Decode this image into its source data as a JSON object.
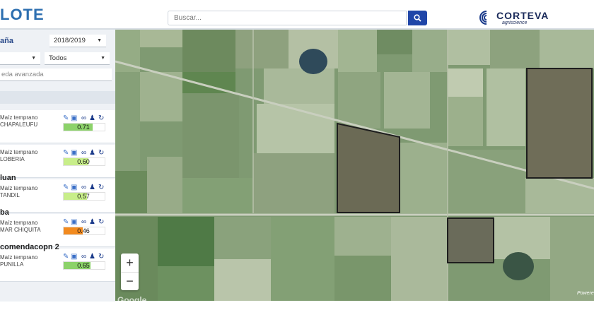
{
  "header": {
    "logo_text": "LOTE",
    "search": {
      "placeholder": "Buscar..."
    },
    "brand": {
      "name": "CORTEVA",
      "tagline": "agriscience"
    }
  },
  "sidebar": {
    "campaign_label": "aña",
    "campaign_value": "2018/2019",
    "filter_value": "Todos",
    "advanced_search": "eda avanzada",
    "cards": [
      {
        "title": "",
        "crop": "Maíz temprano",
        "location": "CHAPALEUFU",
        "value": "0.71",
        "color": "#8cd26a",
        "fill_fraction": 0.71
      },
      {
        "title": "",
        "crop": "Maíz temprano",
        "location": "LOBERIA",
        "value": "0.60",
        "color": "#c8ee8a",
        "fill_fraction": 0.6
      },
      {
        "title": "luan",
        "crop": "Maíz temprano",
        "location": "TANDIL",
        "value": "0.57",
        "color": "#c8ee8a",
        "fill_fraction": 0.57
      },
      {
        "title": "ba",
        "crop": "Maíz temprano",
        "location": "MAR CHIQUITA",
        "value": "0.46",
        "color": "#f28a1e",
        "fill_fraction": 0.46
      },
      {
        "title": "comendacopn 2",
        "crop": "Maíz temprano",
        "location": "PUNILLA",
        "value": "0.65",
        "color": "#8cd26a",
        "fill_fraction": 0.65
      }
    ]
  },
  "map": {
    "zoom_in": "+",
    "zoom_out": "−",
    "attribution": "Powere",
    "provider": "Google"
  }
}
